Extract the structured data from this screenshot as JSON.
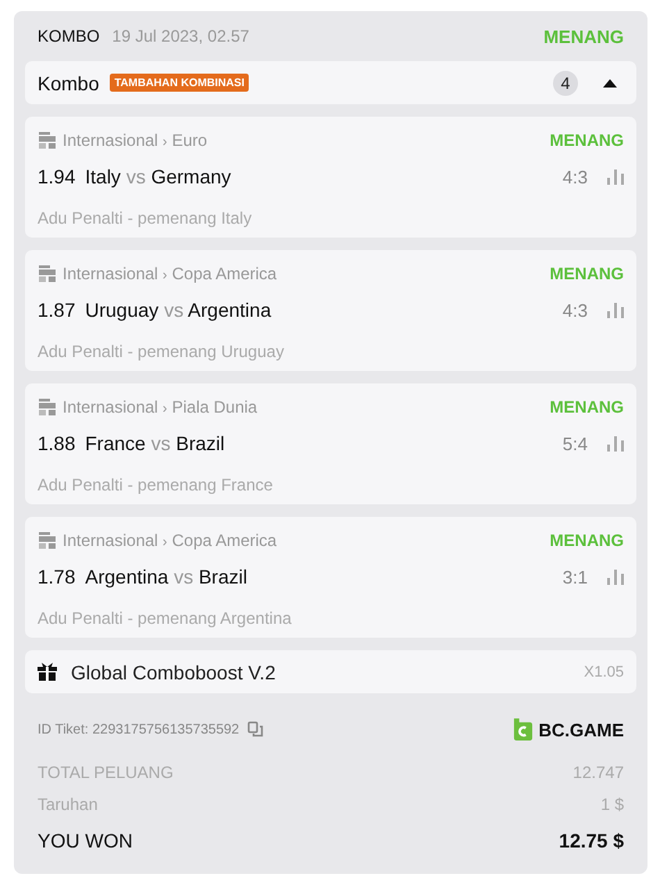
{
  "header": {
    "type": "KOMBO",
    "date": "19 Jul 2023, 02.57",
    "status": "MENANG"
  },
  "combo": {
    "title": "Kombo",
    "badge": "TAMBAHAN KOMBINASI",
    "count": "4",
    "expanded": true
  },
  "matches": [
    {
      "category": "Internasional",
      "separator": "›",
      "league": "Euro",
      "status": "MENANG",
      "odds": "1.94",
      "home": "Italy",
      "vs": "vs",
      "away": "Germany",
      "score": "4:3",
      "market": "Adu Penalti - pemenang Italy"
    },
    {
      "category": "Internasional",
      "separator": "›",
      "league": "Copa America",
      "status": "MENANG",
      "odds": "1.87",
      "home": "Uruguay",
      "vs": "vs",
      "away": "Argentina",
      "score": "4:3",
      "market": "Adu Penalti - pemenang Uruguay"
    },
    {
      "category": "Internasional",
      "separator": "›",
      "league": "Piala Dunia",
      "status": "MENANG",
      "odds": "1.88",
      "home": "France",
      "vs": "vs",
      "away": "Brazil",
      "score": "5:4",
      "market": "Adu Penalti - pemenang France"
    },
    {
      "category": "Internasional",
      "separator": "›",
      "league": "Copa America",
      "status": "MENANG",
      "odds": "1.78",
      "home": "Argentina",
      "vs": "vs",
      "away": "Brazil",
      "score": "3:1",
      "market": "Adu Penalti - pemenang Argentina"
    }
  ],
  "boost": {
    "name": "Global Comboboost V.2",
    "multiplier": "X1.05"
  },
  "ticket": {
    "id": "ID Tiket: 2293175756135735592",
    "brand": "BC.GAME"
  },
  "totals": [
    {
      "kind": "muted",
      "label": "TOTAL PELUANG",
      "value": "12.747"
    },
    {
      "kind": "muted",
      "label": "Taruhan",
      "value": "1 $"
    },
    {
      "kind": "strong",
      "label": "YOU WON",
      "value": "12.75 $"
    }
  ]
}
